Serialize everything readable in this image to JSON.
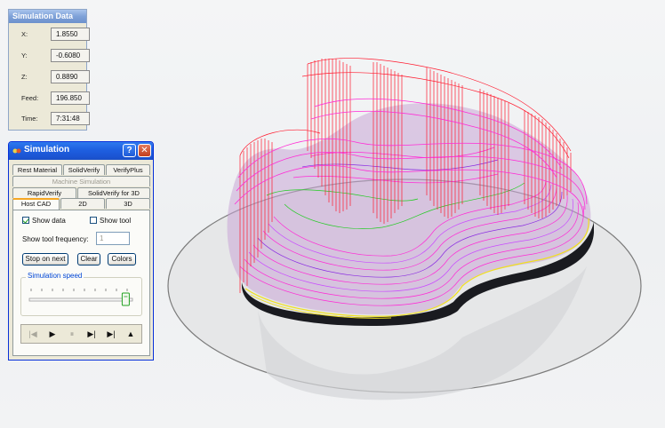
{
  "simulation_data": {
    "title": "Simulation Data",
    "rows": [
      {
        "label": "X:",
        "value": "1.8550"
      },
      {
        "label": "Y:",
        "value": "-0.6080"
      },
      {
        "label": "Z:",
        "value": "0.8890"
      },
      {
        "label": "Feed:",
        "value": "196.850"
      },
      {
        "label": "Time:",
        "value": "7:31:48"
      }
    ]
  },
  "dialog": {
    "title": "Simulation",
    "help_label": "?",
    "close_label": "✕",
    "tabs_row1": [
      "Rest Material",
      "SolidVerify",
      "VerifyPlus"
    ],
    "tabs_row2": [
      "Machine Simulation"
    ],
    "tabs_row3": [
      "RapidVerify",
      "SolidVerify for 3D"
    ],
    "tabs_row4": [
      "Host CAD",
      "2D",
      "3D"
    ],
    "active_tab": "Host CAD",
    "show_data_label": "Show data",
    "show_data_checked": true,
    "show_tool_label": "Show tool",
    "show_tool_checked": false,
    "show_tool_frequency_label": "Show tool frequency:",
    "show_tool_frequency_value": "1",
    "stop_on_next_label": "Stop on next",
    "clear_label": "Clear",
    "colors_label": "Colors",
    "simulation_speed_label": "Simulation speed",
    "simulation_speed": 0.95,
    "player_icons": [
      "skip-to-start-icon",
      "play-icon",
      "pause-icon",
      "step-forward-icon",
      "skip-to-end-icon",
      "eject-icon"
    ],
    "player_glyphs": [
      "|◀",
      "▶",
      "⏸",
      "▶|",
      "▶|",
      "▲"
    ]
  },
  "colors": {
    "toolpath_red": "#ff1a2e",
    "toolpath_magenta": "#ff2bd6",
    "toolpath_purple": "#8a2be2",
    "toolpath_yellow": "#f0e020",
    "toolpath_green": "#22cc22",
    "titlebar_blue": "#1e5fe0"
  }
}
